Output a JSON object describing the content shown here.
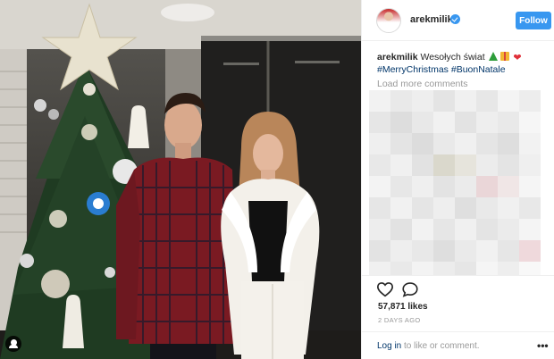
{
  "header": {
    "username": "arekmilik",
    "verified_icon": "verified-badge-icon",
    "follow_label": "Follow",
    "accent_color": "#3897f0"
  },
  "caption": {
    "username": "arekmilik",
    "text": "Wesołych świat",
    "emojis": [
      "christmas-tree-emoji",
      "gift-emoji",
      "heart-emoji"
    ],
    "hashtags": [
      "#MerryChristmas",
      "#BuonNatale"
    ]
  },
  "comments": {
    "load_more_label": "Load more comments"
  },
  "actions": {
    "like_icon": "heart-outline-icon",
    "comment_icon": "speech-bubble-icon",
    "likes_text": "57,871 likes",
    "timestamp": "2 DAYS AGO"
  },
  "login": {
    "link_label": "Log in",
    "suffix": " to like or comment.",
    "more_icon": "more-options-icon",
    "more_glyph": "•••"
  },
  "photo": {
    "user_tag_icon": "user-tag-icon"
  }
}
